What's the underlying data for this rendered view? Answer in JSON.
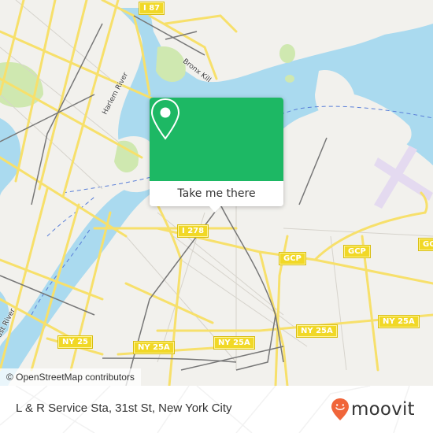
{
  "map": {
    "colors": {
      "land": "#f2f1ed",
      "water": "#aadaef",
      "park": "#cfe8b0",
      "highway": "#f7e06b",
      "rail": "#777777",
      "airport": "#e4daf0",
      "ferry": "#5a7fd8"
    },
    "road_shields": [
      {
        "label": "I 87"
      },
      {
        "label": "I 278"
      },
      {
        "label": "GCP"
      },
      {
        "label": "GCP"
      },
      {
        "label": "GCP"
      },
      {
        "label": "NY 25"
      },
      {
        "label": "NY 25A"
      },
      {
        "label": "NY 25A"
      },
      {
        "label": "NY 25A"
      },
      {
        "label": "NY 25A"
      }
    ],
    "water_labels": [
      {
        "label": "Harlem River"
      },
      {
        "label": "Bronx Kill"
      },
      {
        "label": "East River"
      }
    ],
    "attribution": "© OpenStreetMap contributors"
  },
  "popup": {
    "icon": "map-pin-icon",
    "button_label": "Take me there",
    "color": "#1db864"
  },
  "footer": {
    "place_title": "L & R Service Sta, 31st St, New York City",
    "brand": {
      "name": "moovit",
      "icon": "moovit-pin-smile-icon",
      "color": "#f0653a"
    }
  }
}
